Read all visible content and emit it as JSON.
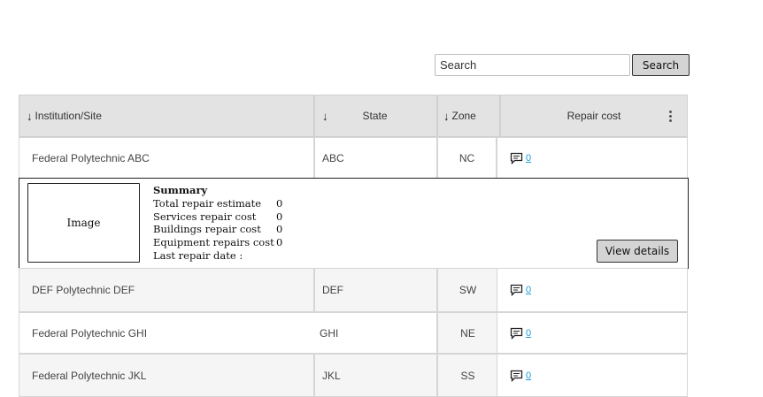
{
  "search": {
    "placeholder": "Search",
    "button_label": "Search"
  },
  "table": {
    "headers": {
      "institution": "Institution/Site",
      "state": "State",
      "zone": "Zone",
      "repair_cost": "Repair cost"
    },
    "sort_icon": "↓",
    "rows": [
      {
        "institution": "Federal Polytechnic ABC",
        "state": "ABC",
        "zone": "NC",
        "comments": "0"
      },
      {
        "institution": "DEF  Polytechnic DEF",
        "state": "DEF",
        "zone": "SW",
        "comments": "0"
      },
      {
        "institution": "Federal Polytechnic GHI",
        "state": "GHI",
        "zone": "NE",
        "comments": "0"
      },
      {
        "institution": "Federal Polytechnic JKL",
        "state": "JKL",
        "zone": "SS",
        "comments": "0"
      }
    ]
  },
  "summary": {
    "image_label": "Image",
    "title": "Summary",
    "items": [
      {
        "label": "Total repair estimate",
        "value": "0"
      },
      {
        "label": "Services repair cost",
        "value": "0"
      },
      {
        "label": "Buildings repair cost",
        "value": "0"
      },
      {
        "label": "Equipment repairs cost",
        "value": "0"
      },
      {
        "label": "Last repair date :",
        "value": ""
      }
    ],
    "view_details_label": "View details"
  },
  "icons": {
    "sort": "arrow-down-icon",
    "comment": "comment-icon",
    "menu": "kebab-menu-icon"
  },
  "colors": {
    "header_bg": "#e3e3e3",
    "link": "#1a9bd7",
    "button_bg": "#d4d4d4"
  }
}
